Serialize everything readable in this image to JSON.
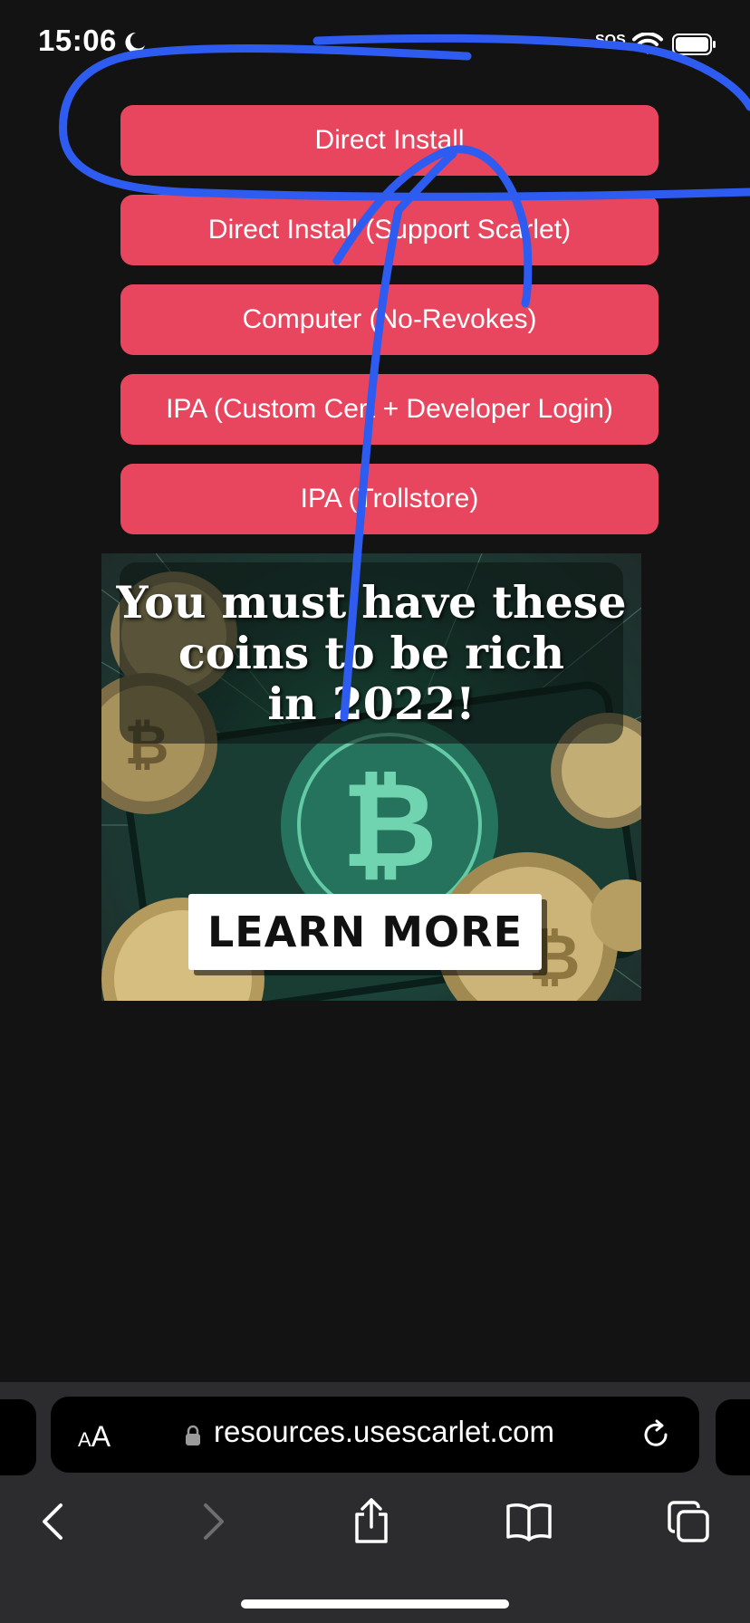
{
  "status_bar": {
    "time": "15:06",
    "sos": "SOS",
    "icons": [
      "moon-icon",
      "wifi-icon",
      "battery-icon"
    ]
  },
  "buttons": [
    "Direct Install",
    "Direct Install (Support Scarlet)",
    "Computer (No-Revokes)",
    "IPA (Custom Cert + Developer Login)",
    "IPA (Trollstore)"
  ],
  "ad": {
    "headline_lines": [
      "You must have these",
      "coins to be rich",
      "in 2022!"
    ],
    "cta": "LEARN MORE"
  },
  "address_bar": {
    "text_size_button": {
      "small": "A",
      "large": "A"
    },
    "url": "resources.usescarlet.com"
  },
  "colors": {
    "page_background": "#131313",
    "button_background": "#e8465e",
    "toolbar_background": "#2c2c2e",
    "annotation_stroke": "#2f5cf0"
  },
  "toolbar_icons": [
    "back-icon",
    "forward-icon",
    "share-icon",
    "bookmarks-icon",
    "tabs-icon"
  ]
}
